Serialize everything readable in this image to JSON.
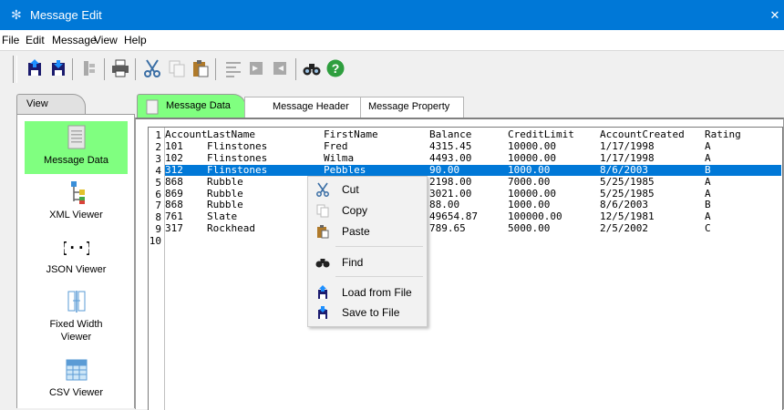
{
  "window": {
    "title": "Message Edit",
    "close_glyph": "✕"
  },
  "menu": [
    "File",
    "Edit",
    "Message",
    "View",
    "Help"
  ],
  "toolbar": {
    "buttons": [
      {
        "name": "load-file-icon"
      },
      {
        "name": "save-file-icon"
      },
      {
        "name": "tools-icon"
      },
      {
        "name": "print-icon"
      },
      {
        "name": "cut-icon"
      },
      {
        "name": "copy-icon"
      },
      {
        "name": "paste-icon"
      },
      {
        "name": "align-icon"
      },
      {
        "name": "indent-icon"
      },
      {
        "name": "outdent-icon"
      },
      {
        "name": "find-icon"
      },
      {
        "name": "help-icon"
      }
    ]
  },
  "left_panel": {
    "tab_label": "View",
    "items": [
      {
        "label": "Message Data",
        "icon": "message-data-icon",
        "active": true
      },
      {
        "label": "XML Viewer",
        "icon": "xml-tree-icon",
        "active": false
      },
      {
        "label": "JSON Viewer",
        "icon": "json-braces-icon",
        "active": false
      },
      {
        "label": "Fixed Width Viewer",
        "icon": "fixed-width-icon",
        "active": false
      },
      {
        "label": "CSV Viewer",
        "icon": "csv-grid-icon",
        "active": false
      }
    ]
  },
  "tabs": [
    "Message Data",
    "Message Header",
    "Message Property"
  ],
  "editor": {
    "line_numbers": [
      "1",
      "2",
      "3",
      "4",
      "5",
      "6",
      "7",
      "8",
      "9",
      "10"
    ],
    "selected_row": 3,
    "rows": [
      [
        "Account",
        "LastName",
        "FirstName",
        "Balance",
        "CreditLimit",
        "AccountCreated",
        "Rating"
      ],
      [
        "101",
        "Flinstones",
        "Fred",
        "4315.45",
        "10000.00",
        "1/17/1998",
        "A"
      ],
      [
        "102",
        "Flinstones",
        "Wilma",
        "4493.00",
        "10000.00",
        "1/17/1998",
        "A"
      ],
      [
        "312",
        "Flinstones",
        "Pebbles",
        "90.00",
        "1000.00",
        "8/6/2003",
        "B"
      ],
      [
        "868",
        "Rubble",
        "",
        "2198.00",
        "7000.00",
        "5/25/1985",
        "A"
      ],
      [
        "869",
        "Rubble",
        "",
        "3021.00",
        "10000.00",
        "5/25/1985",
        "A"
      ],
      [
        "868",
        "Rubble",
        "",
        "88.00",
        "1000.00",
        "8/6/2003",
        "B"
      ],
      [
        "761",
        "Slate",
        "",
        "49654.87",
        "100000.00",
        "12/5/1981",
        "A"
      ],
      [
        "317",
        "Rockhead",
        "",
        "789.65",
        "5000.00",
        "2/5/2002",
        "C"
      ]
    ]
  },
  "context_menu": {
    "items": [
      {
        "label": "Cut",
        "icon": "scissors-icon"
      },
      {
        "label": "Copy",
        "icon": "copy-icon",
        "disabled": true
      },
      {
        "label": "Paste",
        "icon": "clipboard-icon"
      },
      {
        "label": "Find",
        "icon": "binoculars-icon"
      },
      {
        "label": "Load from File",
        "icon": "load-file-icon"
      },
      {
        "label": "Save to File",
        "icon": "save-file-icon"
      }
    ]
  }
}
